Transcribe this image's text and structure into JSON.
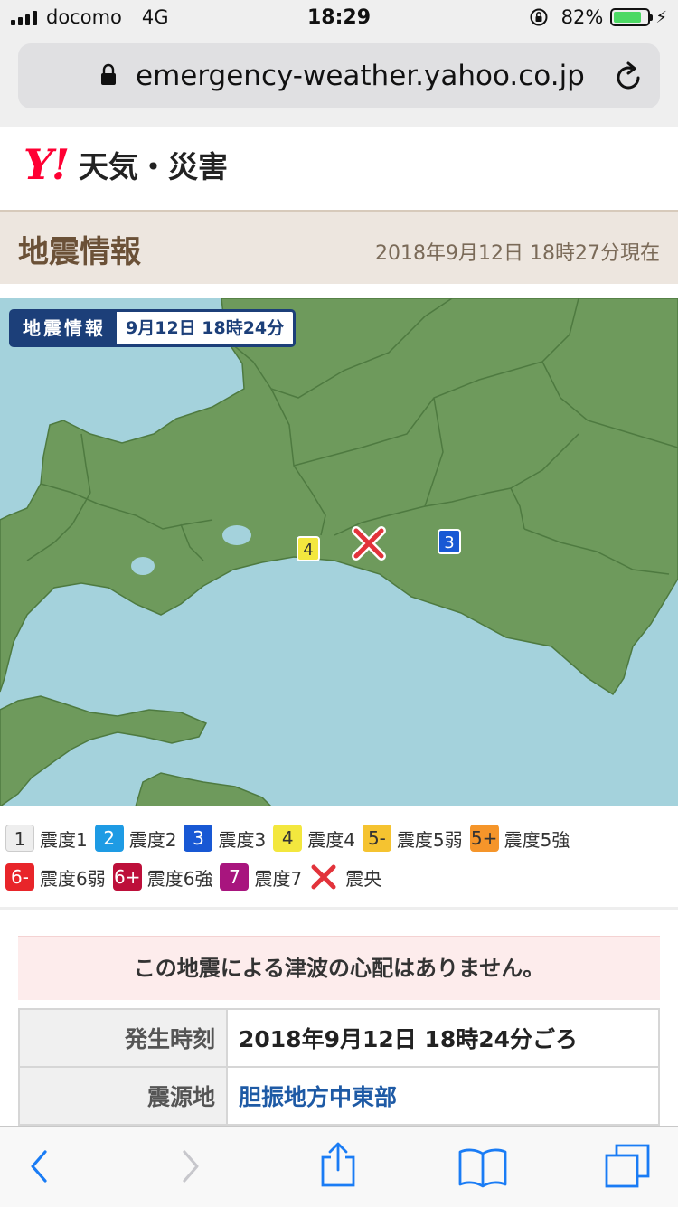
{
  "status_bar": {
    "carrier": "docomo",
    "network": "4G",
    "time": "18:29",
    "battery_percent": "82%",
    "battery_level": 0.82
  },
  "browser": {
    "url": "emergency-weather.yahoo.co.jp"
  },
  "site": {
    "logo_mark": "Y!",
    "logo_text": "天気・災害"
  },
  "page": {
    "title": "地震情報",
    "updated": "2018年9月12日 18時27分現在"
  },
  "map": {
    "badge_label": "地震情報",
    "badge_time": "9月12日 18時24分",
    "markers": [
      {
        "intensity": "4",
        "bg": "#f3e73e",
        "fg": "#333333"
      },
      {
        "intensity": "3",
        "bg": "#1858d4",
        "fg": "#ffffff"
      }
    ],
    "epicenter_icon": "epicenter-x-icon",
    "colors": {
      "sea": "#a4d2dc",
      "land": "#6e9a5c",
      "border": "#4e7a40",
      "lake": "#a4d2dc"
    }
  },
  "legend": {
    "items": [
      {
        "key": "1",
        "label": "震度1",
        "bg": "#eeeeee",
        "fg": "#333333"
      },
      {
        "key": "2",
        "label": "震度2",
        "bg": "#1e9be4",
        "fg": "#ffffff"
      },
      {
        "key": "3",
        "label": "震度3",
        "bg": "#1858d4",
        "fg": "#ffffff"
      },
      {
        "key": "4",
        "label": "震度4",
        "bg": "#f3e73e",
        "fg": "#333333"
      },
      {
        "key": "5-",
        "label": "震度5弱",
        "bg": "#f5c330",
        "fg": "#333333"
      },
      {
        "key": "5+",
        "label": "震度5強",
        "bg": "#f5952a",
        "fg": "#333333"
      },
      {
        "key": "6-",
        "label": "震度6弱",
        "bg": "#e8252a",
        "fg": "#ffffff"
      },
      {
        "key": "6+",
        "label": "震度6強",
        "bg": "#bd0f3a",
        "fg": "#ffffff"
      },
      {
        "key": "7",
        "label": "震度7",
        "bg": "#a8157e",
        "fg": "#ffffff"
      },
      {
        "key": "×",
        "label": "震央",
        "icon": "epicenter-x-icon"
      }
    ]
  },
  "tsunami_notice": "この地震による津波の心配はありません。",
  "details": [
    {
      "label": "発生時刻",
      "value": "2018年9月12日 18時24分ごろ",
      "is_link": false
    },
    {
      "label": "震源地",
      "value": "胆振地方中東部",
      "is_link": true
    }
  ],
  "toolbar": {
    "icons": [
      "back-icon",
      "forward-icon",
      "share-icon",
      "bookmarks-icon",
      "tabs-icon"
    ]
  }
}
